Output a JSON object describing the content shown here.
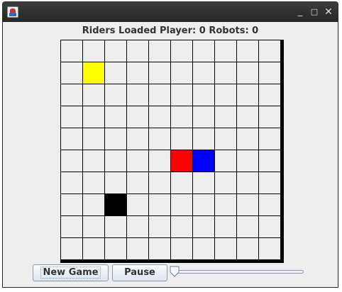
{
  "window": {
    "minimize_glyph": "_",
    "maximize_glyph": "□",
    "close_glyph": "✕"
  },
  "status_text": "Riders Loaded Player: 0 Robots: 0",
  "board": {
    "rows": 10,
    "cols": 10,
    "empty_color": "#eeeeee",
    "grid_line_color": "#000000",
    "pieces": [
      {
        "row": 1,
        "col": 1,
        "color": "#ffff00"
      },
      {
        "row": 5,
        "col": 5,
        "color": "#ff0000"
      },
      {
        "row": 5,
        "col": 6,
        "color": "#0000ff"
      },
      {
        "row": 7,
        "col": 2,
        "color": "#000000"
      }
    ]
  },
  "controls": {
    "new_game_label": "New Game",
    "pause_label": "Pause",
    "speed_slider_value": 0
  }
}
